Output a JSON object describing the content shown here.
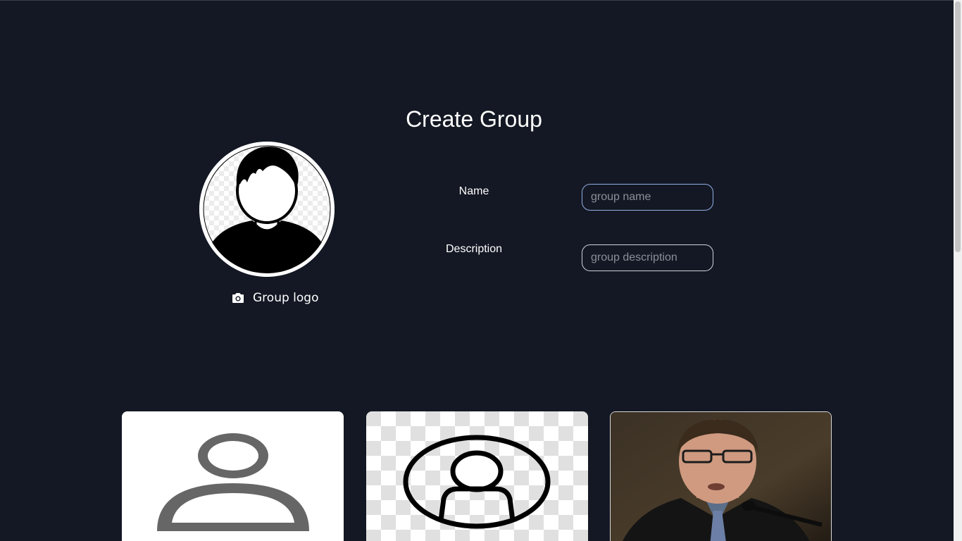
{
  "page": {
    "title": "Create Group"
  },
  "logo": {
    "caption": "Group logo",
    "camera_icon": "camera-icon",
    "placeholder_icon": "user-avatar-icon"
  },
  "form": {
    "name_label": "Name",
    "name_placeholder": "group name",
    "description_label": "Description",
    "description_placeholder": "group description"
  },
  "logo_options": [
    {
      "icon": "user-outline-icon"
    },
    {
      "icon": "user-circle-icon"
    },
    {
      "icon": "photo-portrait"
    }
  ],
  "colors": {
    "background": "#141824",
    "focused_border": "#8fb0e4",
    "field_border": "#d0d3da"
  }
}
